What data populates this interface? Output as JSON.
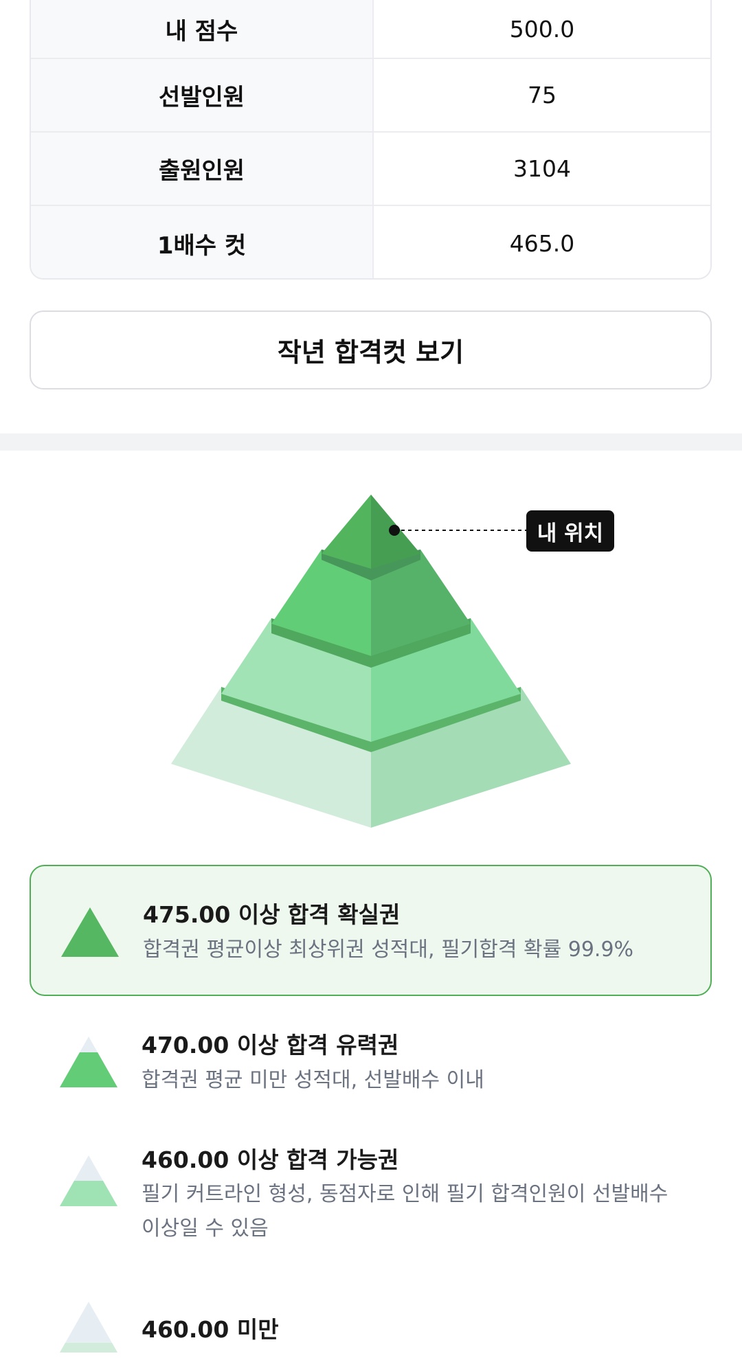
{
  "stats": [
    {
      "label": "내 점수",
      "value": "500.0"
    },
    {
      "label": "선발인원",
      "value": "75"
    },
    {
      "label": "출원인원",
      "value": "3104"
    },
    {
      "label": "1배수 컷",
      "value": "465.0"
    }
  ],
  "button": {
    "label": "작년 합격컷 보기"
  },
  "pyramid": {
    "my_position_label": "내 위치"
  },
  "legend": [
    {
      "title": "475.00 이상 합격 확실권",
      "desc": "합격권 평균이상 최상위권 성적대, 필기합격 확률 99.9%"
    },
    {
      "title": "470.00 이상 합격 유력권",
      "desc": "합격권 평균 미만 성적대, 선발배수 이내"
    },
    {
      "title": "460.00 이상 합격 가능권",
      "desc": "필기 커트라인 형성, 동점자로 인해 필기 합격인원이 선발배수 이상일 수 있음"
    },
    {
      "title": "460.00 미만",
      "desc": ""
    }
  ],
  "colors": {
    "tier1": "#55b761",
    "tier2": "#63cc76",
    "tier3": "#9fe3b4",
    "tier4": "#d1ecdb",
    "highlight_bg": "#eef8ee",
    "highlight_border": "#4fae56"
  }
}
